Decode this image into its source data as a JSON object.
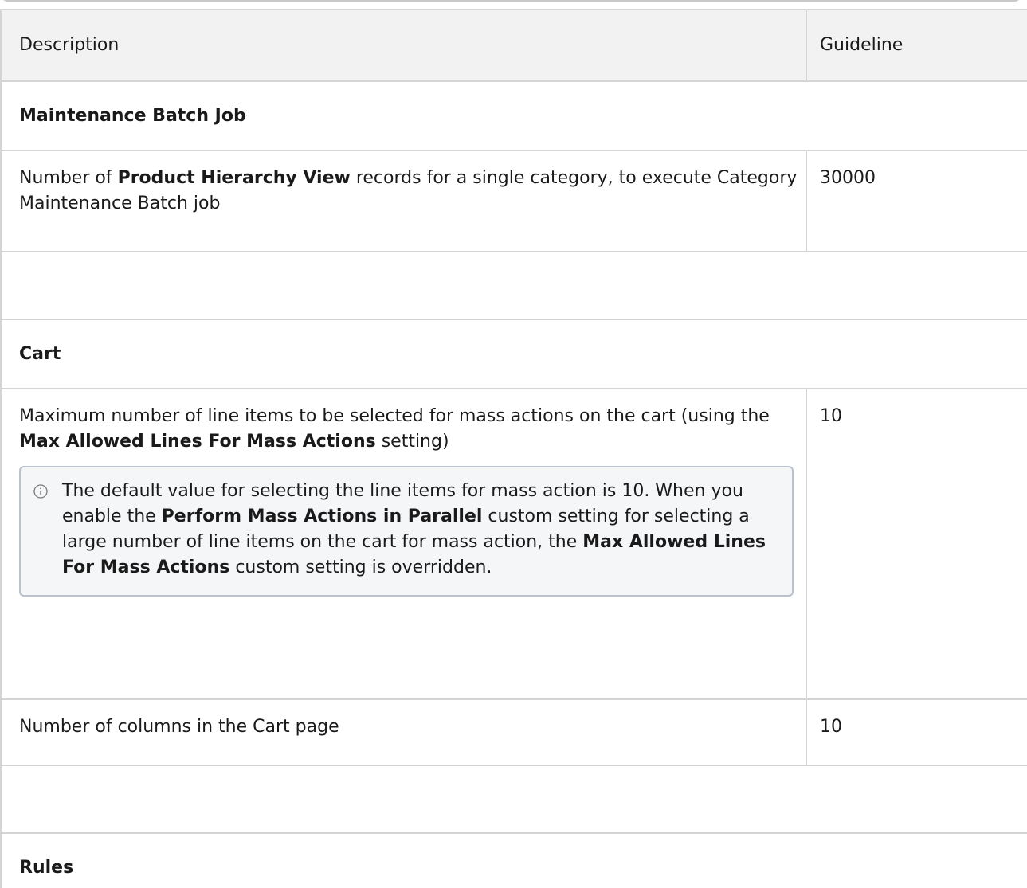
{
  "table": {
    "headers": {
      "description": "Description",
      "guideline": "Guideline"
    },
    "sections": {
      "maintenance": "Maintenance Batch Job",
      "cart": "Cart",
      "rules": "Rules"
    },
    "rows": {
      "maintenance": {
        "desc_before": "Number of ",
        "desc_bold": "Product Hierarchy View",
        "desc_after": " records for a single category, to execute Category Maintenance Batch job",
        "guideline": "30000"
      },
      "mass_actions": {
        "desc_before": "Maximum number of line items to be selected for mass actions on the cart (using the ",
        "desc_bold": "Max Allowed Lines For Mass Actions",
        "desc_after": " setting)",
        "guideline": "10",
        "note": {
          "icon": "info-icon",
          "text_1": "The default value for selecting the line items for mass action is 10. When you enable the ",
          "bold_1": "Perform Mass Actions in Parallel",
          "text_2": " custom setting for selecting a large number of line items on the cart for mass action, the ",
          "bold_2": "Max Allowed Lines For Mass Actions",
          "text_3": " custom setting is overridden."
        }
      },
      "cart_columns": {
        "desc": "Number of columns in the Cart page",
        "guideline": "10"
      }
    }
  },
  "colors": {
    "header_bg": "#f2f2f2",
    "border": "#d4d4d4",
    "note_bg": "#f5f6f8",
    "note_border": "#b9c3cd"
  }
}
